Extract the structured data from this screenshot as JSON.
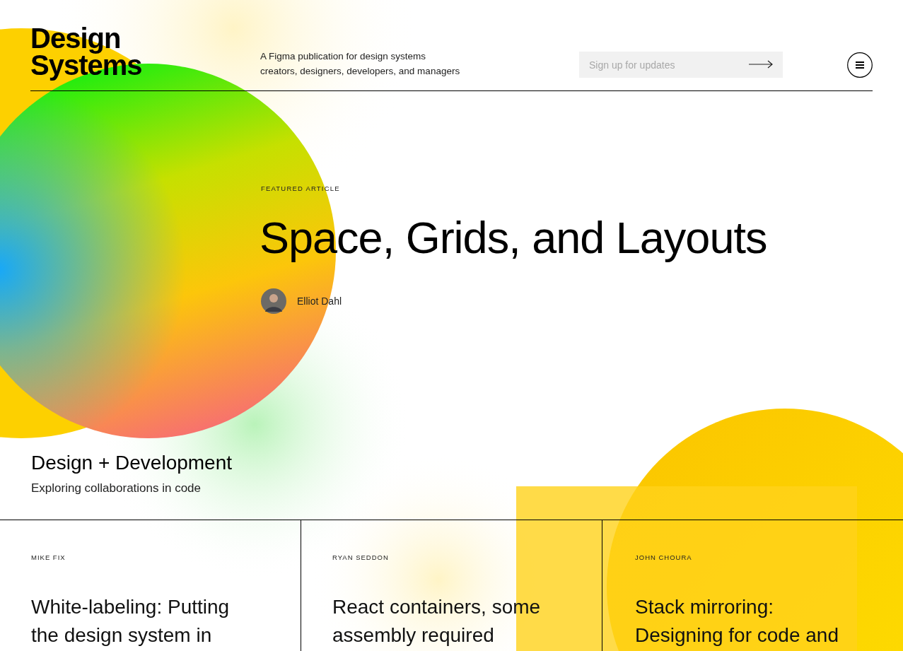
{
  "logo": {
    "line_1": "Design",
    "line_2": "Systems"
  },
  "tagline": {
    "line_1": "A Figma publication for design systems",
    "line_2": "creators, designers, developers, and managers"
  },
  "signup": {
    "placeholder": "Sign up for updates"
  },
  "featured": {
    "label": "FEATURED ARTICLE",
    "title": "Space, Grids, and Layouts",
    "author": "Elliot Dahl"
  },
  "section": {
    "title": "Design + Development",
    "subtitle": "Exploring collaborations in code"
  },
  "articles": [
    {
      "author": "MIKE FIX",
      "title": "White-labeling: Putting the design system in"
    },
    {
      "author": "RYAN SEDDON",
      "title": "React containers, some assembly required"
    },
    {
      "author": "JOHN CHOURA",
      "title": "Stack mirroring: Designing for code and"
    }
  ]
}
